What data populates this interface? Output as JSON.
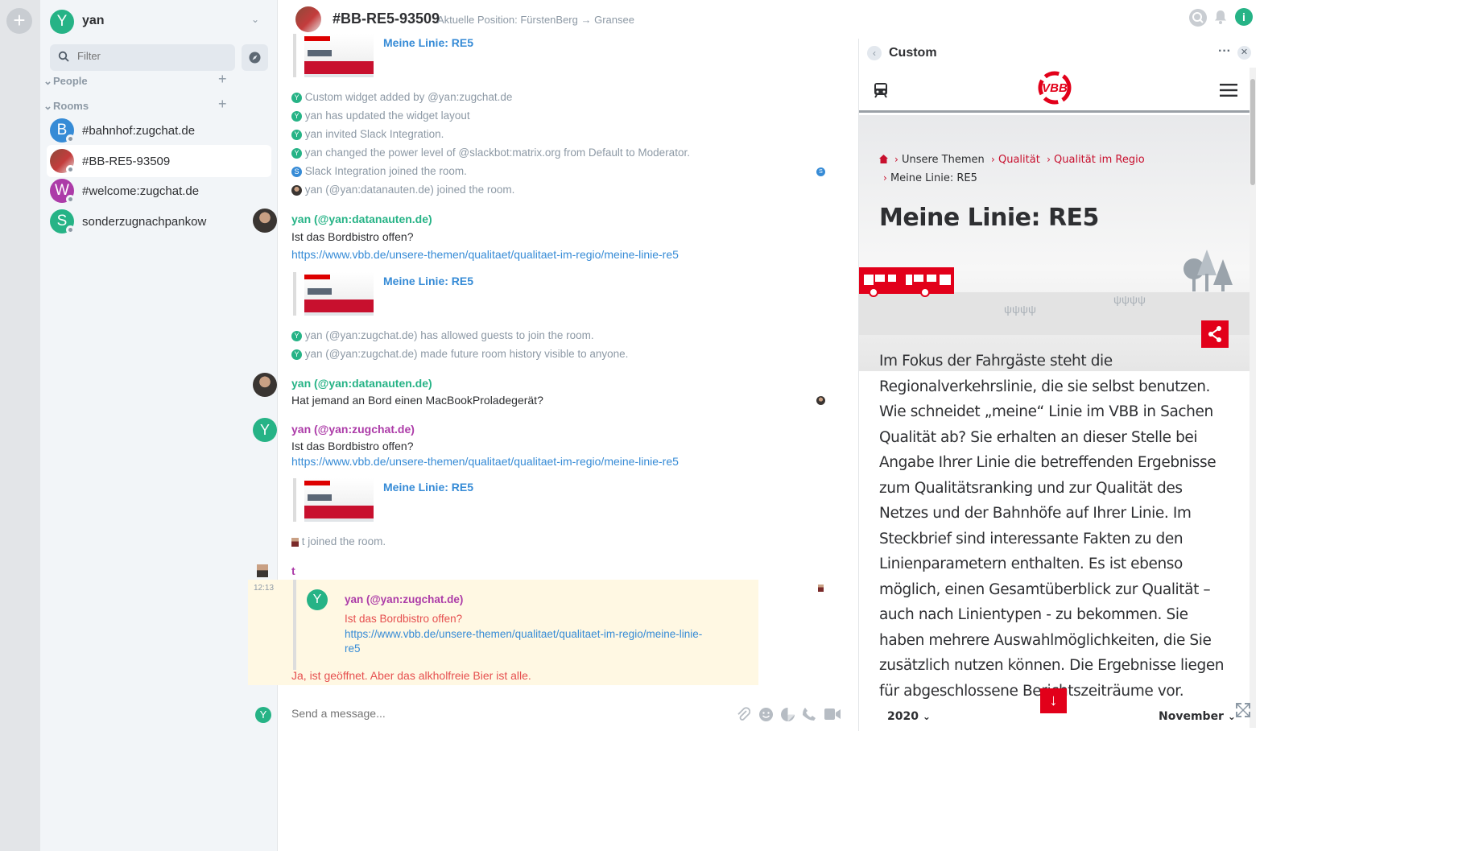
{
  "sidebar": {
    "user_initial": "Y",
    "user_name": "yan",
    "filter_placeholder": "Filter",
    "section_people": "People",
    "section_rooms": "Rooms",
    "rooms": [
      {
        "initial": "B",
        "label": "#bahnhof:zugchat.de",
        "color": "#368bd6"
      },
      {
        "initial": "",
        "label": "#BB-RE5-93509",
        "color": "#c43c3c"
      },
      {
        "initial": "W",
        "label": "#welcome:zugchat.de",
        "color": "#ac3ba8"
      },
      {
        "initial": "S",
        "label": "sonderzugnachpankow",
        "color": "#26b386"
      }
    ]
  },
  "room": {
    "title": "#BB-RE5-93509",
    "topic": "Aktuelle Position: FürstenBerg → Gransee"
  },
  "timeline": {
    "preview_title": "Meine Linie: RE5",
    "events_top": [
      {
        "initial": "Y",
        "text": "Custom widget added by @yan:zugchat.de",
        "color": "#26b386"
      },
      {
        "initial": "Y",
        "text": "yan has updated the widget layout",
        "color": "#26b386"
      },
      {
        "initial": "Y",
        "text": "yan invited Slack Integration.",
        "color": "#26b386"
      },
      {
        "initial": "Y",
        "text": "yan changed the power level of @slackbot:matrix.org from Default to Moderator.",
        "color": "#26b386"
      },
      {
        "initial": "S",
        "text": "Slack Integration joined the room.",
        "color": "#368bd6"
      },
      {
        "initial": "",
        "text": "yan (@yan:datanauten.de) joined the room.",
        "color": "#5a4a42"
      }
    ],
    "msg1_sender": "yan (@yan:datanauten.de)",
    "msg1_text": "Ist das Bordbistro offen?",
    "link": "https://www.vbb.de/unsere-themen/qualitaet/qualitaet-im-regio/meine-linie-re5",
    "events_mid": [
      {
        "initial": "Y",
        "text": "yan (@yan:zugchat.de) has allowed guests to join the room.",
        "color": "#26b386"
      },
      {
        "initial": "Y",
        "text": "yan (@yan:zugchat.de) made future room history visible to anyone.",
        "color": "#26b386"
      }
    ],
    "msg2_sender": "yan (@yan:datanauten.de)",
    "msg2_text": "Hat jemand an Bord einen MacBookProladegerät?",
    "msg3_initial": "Y",
    "msg3_sender": "yan (@yan:zugchat.de)",
    "msg3_text": "Ist das Bordbistro offen?",
    "join_t": "t joined the room.",
    "msg4_sender": "t",
    "msg4_time": "12:13",
    "quote_initial": "Y",
    "quote_sender": "yan (@yan:zugchat.de)",
    "quote_text": "Ist das Bordbistro offen?",
    "quote_link_1": "https://www.vbb.de/unsere-themen/qualitaet/qualitaet-im-regio/meine-linie-",
    "quote_link_2": "re5",
    "reply_text": "Ja, ist geöffnet. Aber das alkholfreie Bier ist alle."
  },
  "composer": {
    "avatar_initial": "Y",
    "placeholder": "Send a message..."
  },
  "widget": {
    "title": "Custom",
    "menu_glyph": "···",
    "logo_text": "VBB",
    "breadcrumb": [
      "Unsere Themen",
      "Qualität",
      "Qualität im Regio",
      "Meine Linie: RE5"
    ],
    "heading": "Meine Linie: RE5",
    "body": "Im Fokus der Fahrgäste steht die Regionalverkehrslinie, die sie selbst benutzen. Wie schneidet „meine“ Linie im VBB in Sachen Qualität ab? Sie erhalten an dieser Stelle bei Angabe Ihrer Linie die betreffenden Ergebnisse zum Qualitätsranking und zur Qualität des Netzes und der Bahnhöfe auf Ihrer Linie. Im Steckbrief sind interessante Fakten zu den Linienparametern enthalten. Es ist ebenso möglich, einen Gesamtüberblick zur Qualität – auch nach Linientypen - zu bekommen. Sie haben mehrere Auswahlmöglichkeiten, die Sie zusätzlich nutzen können. Die Ergebnisse liegen für abgeschlossene Berichtszeiträume vor.",
    "year_select": "2020",
    "month_select": "November",
    "accent": "#e2001a"
  }
}
